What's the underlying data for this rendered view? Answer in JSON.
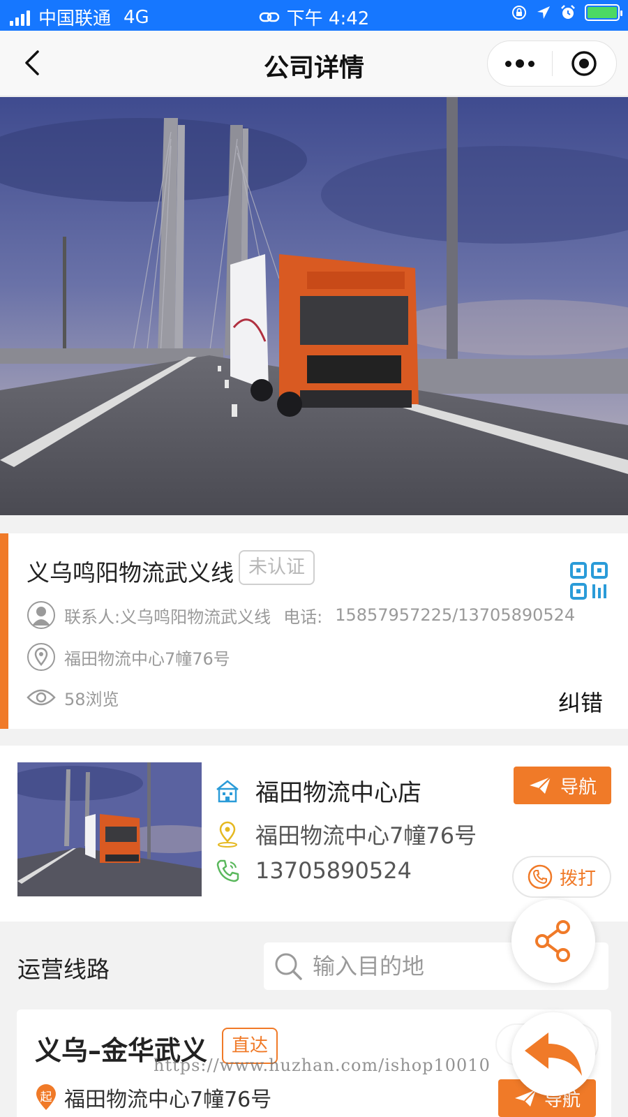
{
  "status_bar": {
    "carrier": "中国联通",
    "network": "4G",
    "time": "下午 4:42"
  },
  "nav": {
    "title": "公司详情"
  },
  "company": {
    "name": "义乌鸣阳物流武义线",
    "badge": "未认证",
    "contact": "联系人:义乌鸣阳物流武义线",
    "phone_label": "电话:",
    "phones": "15857957225/13705890524",
    "address": "福田物流中心7幢76号",
    "views": "58浏览",
    "correct_label": "纠错"
  },
  "store": {
    "name": "福田物流中心店",
    "address": "福田物流中心7幢76号",
    "phone": "13705890524",
    "nav_label": "导航",
    "call_label": "拨打"
  },
  "routes": {
    "title": "运营线路",
    "search_placeholder": "输入目的地",
    "items": [
      {
        "name": "义乌–金华武义",
        "badge": "直达",
        "start_marker": "起",
        "start": "福田物流中心7幢76号",
        "fav_label": "收藏",
        "nav_label": "导航"
      }
    ]
  },
  "watermark": "https://www.huzhan.com/ishop10010",
  "colors": {
    "status_bar": "#1677ff",
    "accent": "#f07a28",
    "muted_text": "#9a9a9a",
    "qr_icon": "#2a9bd8"
  }
}
